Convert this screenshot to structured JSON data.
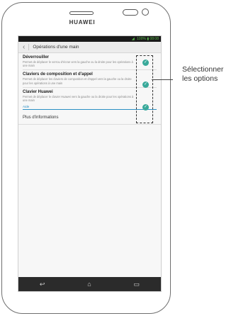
{
  "device": {
    "brand": "HUAWEI"
  },
  "status_bar": {
    "battery": "100%",
    "time": "08:08"
  },
  "header": {
    "title": "Opérations d'une main"
  },
  "options": [
    {
      "title": "Déverrouiller",
      "description": "Permet de déplacer le verrou d'écran vers la gauche ou la droite pour les opérations à une main",
      "checked": true
    },
    {
      "title": "Claviers de composition et d'appel",
      "description": "Permet de déplacer les claviers de composition et d'appel vers la gauche ou la droite pour les opérations à une main",
      "checked": true
    },
    {
      "title": "Clavier Huawei",
      "description": "Permet de déplacer le clavier Huawei vers la gauche ou la droite pour les opérations à une main",
      "checked": true
    }
  ],
  "aide_label": "Aide",
  "more_label": "Plus d'informations",
  "callout": {
    "line1": "Sélectionner",
    "line2": "les options"
  },
  "colors": {
    "accent": "#39a99a",
    "link": "#2b8fc4"
  }
}
